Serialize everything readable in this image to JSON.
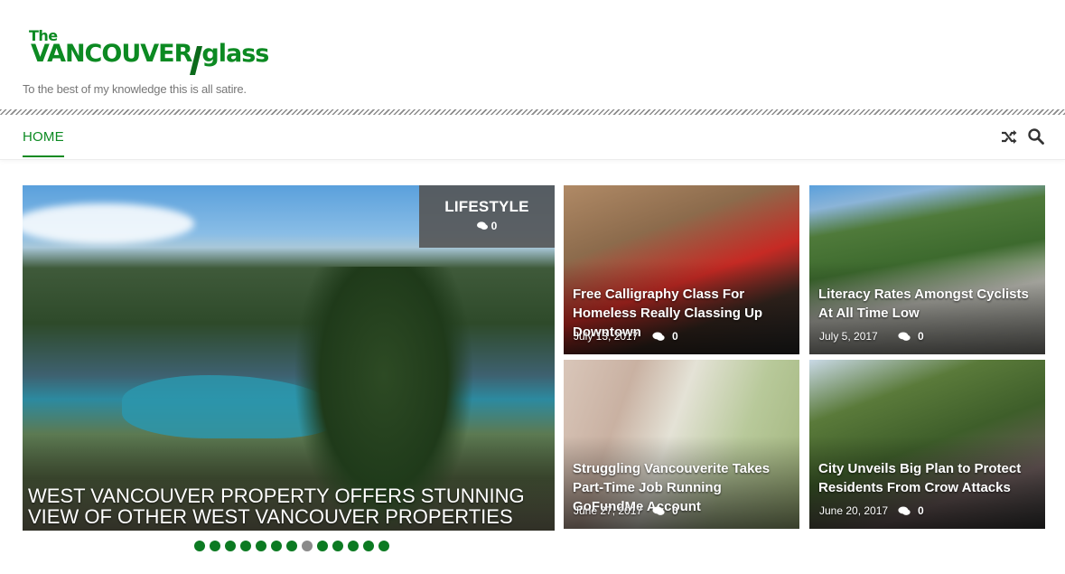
{
  "site": {
    "logo_the": "The",
    "logo_main": "VANCOUVER",
    "logo_glass": "glass",
    "tagline": "To the best of my knowledge this is all satire."
  },
  "nav": {
    "items": [
      {
        "label": "HOME"
      }
    ],
    "icons": [
      "shuffle-icon",
      "search-icon"
    ]
  },
  "colors": {
    "accent": "#0c8a22",
    "badge_bg": "#555555"
  },
  "featured": {
    "category": "LIFESTYLE",
    "comments": "0",
    "title": "WEST VANCOUVER PROPERTY OFFERS STUNNING VIEW OF OTHER WEST VANCOUVER PROPERTIES"
  },
  "posts": [
    {
      "title": "Free Calligraphy Class For Homeless Really Classing Up Downtown",
      "date": "July 13, 2017",
      "comments": "0"
    },
    {
      "title": "Literacy Rates Amongst Cyclists At All Time Low",
      "date": "July 5, 2017",
      "comments": "0"
    },
    {
      "title": "Struggling Vancouverite Takes Part-Time Job Running GoFundMe Account",
      "date": "June 27, 2017",
      "comments": "0"
    },
    {
      "title": "City Unveils Big Plan to Protect Residents From Crow Attacks",
      "date": "June 20, 2017",
      "comments": "0"
    }
  ],
  "slider": {
    "total": 13,
    "active": 8
  }
}
